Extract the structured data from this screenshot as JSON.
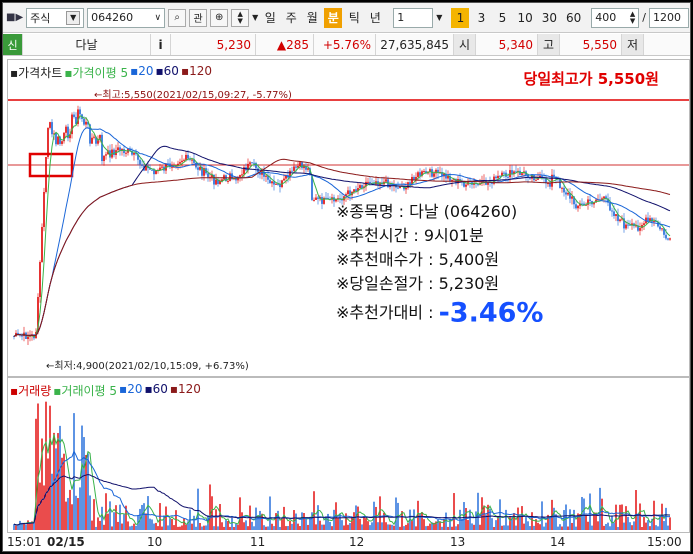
{
  "toolbar": {
    "market": "주식",
    "code": "064260",
    "search_icon": "search-icon",
    "watch": "관",
    "periods": [
      "일",
      "주",
      "월",
      "분",
      "틱",
      "년"
    ],
    "active_period": "분",
    "count": "1",
    "intervals": [
      "1",
      "3",
      "5",
      "10",
      "30",
      "60"
    ],
    "active_interval": "1",
    "bars": "400",
    "right_value": "1200"
  },
  "quote": {
    "tag": "신",
    "name": "다날",
    "info_icon": "i",
    "price": "5,230",
    "change": "▲285",
    "change_pct": "+5.76%",
    "volume": "27,635,845",
    "open_label": "시",
    "open": "5,340",
    "high_label": "고",
    "high": "5,550",
    "low_label": "저"
  },
  "price_pane": {
    "legend": [
      "가격차트",
      "가격이평",
      "5",
      "20",
      "60",
      "120"
    ],
    "high_title": "당일최고가 5,550원",
    "high_annotation": "←최고:5,550(2021/02/15,09:27, -5.77%)",
    "low_annotation": "←최저:4,900(2021/02/10,15:09, +6.73%)"
  },
  "info": {
    "name": "※종목명 : 다날 (064260)",
    "time": "※추천시간 : 9시01분",
    "buy": "※추천매수가 : 5,400원",
    "stop": "※당일손절가 : 5,230원",
    "compare": "※추천가대비 :",
    "compare_value": "-3.46%"
  },
  "volume_pane": {
    "legend": [
      "거래량",
      "거래이평",
      "5",
      "20",
      "60",
      "120"
    ]
  },
  "xaxis": [
    "15:01",
    "02/15",
    "10",
    "11",
    "12",
    "13",
    "14",
    "15:00"
  ],
  "colors": {
    "up": "#e00000",
    "down": "#1a66d8",
    "ma5": "#3ab34a",
    "ma20": "#1a66d8",
    "ma60": "#10106b",
    "ma120": "#8b1a1a"
  }
}
